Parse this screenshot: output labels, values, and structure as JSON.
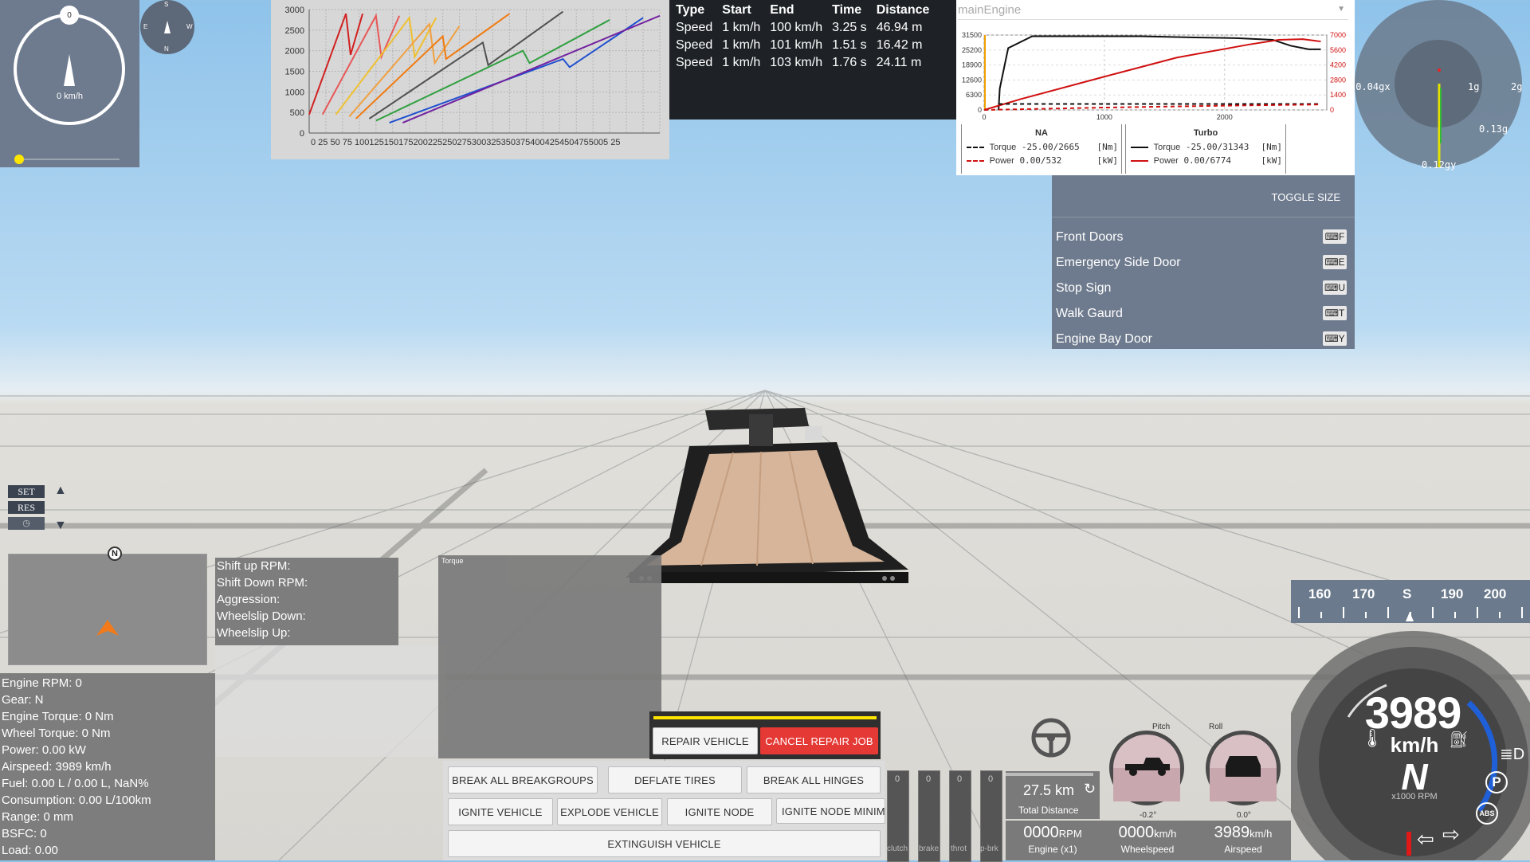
{
  "compass": {
    "speed_badge": "0",
    "speed": "0 km/h"
  },
  "mini_compass": {
    "n": "N",
    "s": "S",
    "e": "E",
    "w": "W"
  },
  "accel_chart": {
    "chart_data": {
      "type": "line",
      "title": "",
      "ylim": [
        0,
        3000
      ],
      "y_ticks": [
        0,
        500,
        1000,
        1500,
        2000,
        2500,
        3000
      ],
      "x_tick_text": "0 25 50 75 1001251501752002252502753003253503754004254504755005 25",
      "series": [
        {
          "color": "#d22020",
          "points": [
            [
              0,
              450
            ],
            [
              55,
              2900
            ],
            [
              62,
              1900
            ],
            [
              80,
              2900
            ]
          ]
        },
        {
          "color": "#e85858",
          "points": [
            [
              20,
              450
            ],
            [
              100,
              2850
            ],
            [
              108,
              1850
            ],
            [
              135,
              2850
            ]
          ]
        },
        {
          "color": "#f0c030",
          "points": [
            [
              40,
              450
            ],
            [
              150,
              2800
            ],
            [
              158,
              1850
            ],
            [
              190,
              2800
            ]
          ]
        },
        {
          "color": "#f0a040",
          "points": [
            [
              60,
              400
            ],
            [
              180,
              2650
            ],
            [
              188,
              1700
            ],
            [
              225,
              2600
            ]
          ]
        },
        {
          "color": "#f07a10",
          "points": [
            [
              70,
              350
            ],
            [
              200,
              2350
            ],
            [
              205,
              1800
            ],
            [
              300,
              2900
            ]
          ]
        },
        {
          "color": "#505050",
          "points": [
            [
              90,
              350
            ],
            [
              260,
              2200
            ],
            [
              268,
              1650
            ],
            [
              380,
              2950
            ]
          ]
        },
        {
          "color": "#30a040",
          "points": [
            [
              100,
              300
            ],
            [
              320,
              2000
            ],
            [
              330,
              1700
            ],
            [
              450,
              2750
            ]
          ]
        },
        {
          "color": "#2050d0",
          "points": [
            [
              120,
              250
            ],
            [
              380,
              1800
            ],
            [
              390,
              1600
            ],
            [
              500,
              2800
            ]
          ]
        },
        {
          "color": "#7020a0",
          "points": [
            [
              140,
              250
            ],
            [
              525,
              2850
            ]
          ]
        }
      ]
    }
  },
  "accel_table": {
    "headers": [
      "Type",
      "Start",
      "End",
      "Time",
      "Distance"
    ],
    "rows": [
      [
        "Speed",
        "1 km/h",
        "100 km/h",
        "3.25 s",
        "46.94 m"
      ],
      [
        "Speed",
        "1 km/h",
        "101 km/h",
        "1.51 s",
        "16.42 m"
      ],
      [
        "Speed",
        "1 km/h",
        "103 km/h",
        "1.76 s",
        "24.11 m"
      ]
    ]
  },
  "engine_graph": {
    "dropdown": "mainEngine",
    "chart_data": {
      "type": "line",
      "xlim": [
        0,
        2850
      ],
      "x_ticks": [
        "0",
        "1000",
        "2000"
      ],
      "left_ticks": [
        "31500",
        "25200",
        "18900",
        "12600",
        "6300",
        "0"
      ],
      "right_ticks": [
        "7000",
        "5600",
        "4200",
        "2800",
        "1400",
        "0"
      ],
      "series": [
        {
          "color": "#111111",
          "points": [
            [
              120,
              0
            ],
            [
              130,
              9000
            ],
            [
              200,
              26000
            ],
            [
              400,
              31000
            ],
            [
              1300,
              31000
            ],
            [
              1750,
              30500
            ],
            [
              2100,
              30200
            ],
            [
              2400,
              29500
            ],
            [
              2550,
              27000
            ],
            [
              2700,
              25500
            ],
            [
              2800,
              25500
            ]
          ]
        },
        {
          "color": "#d01010",
          "points": [
            [
              0,
              0
            ],
            [
              300,
              4500
            ],
            [
              1000,
              14000
            ],
            [
              1600,
              22000
            ],
            [
              2200,
              27500
            ],
            [
              2450,
              29500
            ],
            [
              2650,
              29800
            ],
            [
              2800,
              28800
            ]
          ]
        },
        {
          "color": "#111111",
          "dashed": true,
          "points": [
            [
              120,
              2500
            ],
            [
              2800,
              2500
            ]
          ]
        },
        {
          "color": "#d01010",
          "dashed": true,
          "points": [
            [
              0,
              0
            ],
            [
              1000,
              1000
            ],
            [
              2000,
              1800
            ],
            [
              2800,
              2300
            ]
          ]
        }
      ]
    },
    "na": {
      "title": "NA",
      "torque_label": "Torque",
      "torque_val": "-25.00/2665",
      "torque_unit": "[Nm]",
      "power_label": "Power",
      "power_val": "0.00/532",
      "power_unit": "[kW]"
    },
    "turbo": {
      "title": "Turbo",
      "torque_label": "Torque",
      "torque_val": "-25.00/31343",
      "torque_unit": "[Nm]",
      "power_label": "Power",
      "power_val": "0.00/6774",
      "power_unit": "[kW]"
    }
  },
  "gforce": {
    "left": "-0.04gx",
    "g1": "1g",
    "g2": "2g",
    "right": "0.13g",
    "bottom": "0.12gy"
  },
  "parts": {
    "toggle": "TOGGLE SIZE",
    "items": [
      {
        "label": "Front Doors",
        "key": "F"
      },
      {
        "label": "Emergency Side Door",
        "key": "E"
      },
      {
        "label": "Stop Sign",
        "key": "U"
      },
      {
        "label": "Walk Gaurd",
        "key": "T"
      },
      {
        "label": "Engine Bay Door",
        "key": "Y"
      }
    ]
  },
  "cruise": {
    "set": "SET",
    "res": "RES"
  },
  "minimap": {
    "north": "N"
  },
  "shift_info": [
    "Shift up RPM:",
    "Shift Down RPM:",
    "Aggression:",
    "Wheelslip Down:",
    "Wheelslip Up:"
  ],
  "torque_panel": {
    "title": "Torque"
  },
  "debug": [
    "Engine RPM: 0",
    "Gear: N",
    "Engine Torque: 0 Nm",
    "Wheel Torque: 0 Nm",
    "Power: 0.00 kW",
    "Airspeed: 3989 km/h",
    "Fuel: 0.00 L / 0.00 L, NaN%",
    "Consumption: 0.00 L/100km",
    "Range: 0 mm",
    "BSFC: 0",
    "Load: 0.00"
  ],
  "repair": {
    "repair": "REPAIR VEHICLE",
    "cancel": "CANCEL REPAIR JOB"
  },
  "actions": {
    "break_groups": "BREAK ALL BREAKGROUPS",
    "deflate": "DEFLATE TIRES",
    "break_hinges": "BREAK ALL HINGES",
    "ignite": "IGNITE VEHICLE",
    "explode": "EXPLODE VEHICLE",
    "ignite_node": "IGNITE NODE",
    "ignite_node_min": "IGNITE NODE MINIMAL",
    "extinguish": "EXTINGUISH VEHICLE"
  },
  "pedals": {
    "values": [
      "0",
      "0",
      "0",
      "0"
    ],
    "labels": [
      "clutch",
      "brake",
      "throt",
      "p-brk"
    ]
  },
  "trip": {
    "distance": "27.5 km",
    "label": "Total Distance"
  },
  "attitude": {
    "pitch_label": "Pitch",
    "pitch_val": "-0.2°",
    "roll_label": "Roll",
    "roll_val": "0.0°"
  },
  "readouts": [
    {
      "value": "0000",
      "unit": "RPM",
      "label": "Engine (x1)"
    },
    {
      "value": "0000",
      "unit": "km/h",
      "label": "Wheelspeed"
    },
    {
      "value": "3989",
      "unit": "km/h",
      "label": "Airspeed"
    }
  ],
  "heading_tape": {
    "ticks": [
      "160",
      "170",
      "S",
      "190",
      "200"
    ]
  },
  "dash": {
    "speed": "3989",
    "unit": "km/h",
    "gear": "N",
    "rpm_label": "x1000 RPM",
    "park": "P",
    "abs": "ABS"
  },
  "colors": {
    "panel": "#6e7b8e",
    "repair_red": "#e53935",
    "yellow": "#ffe500"
  }
}
